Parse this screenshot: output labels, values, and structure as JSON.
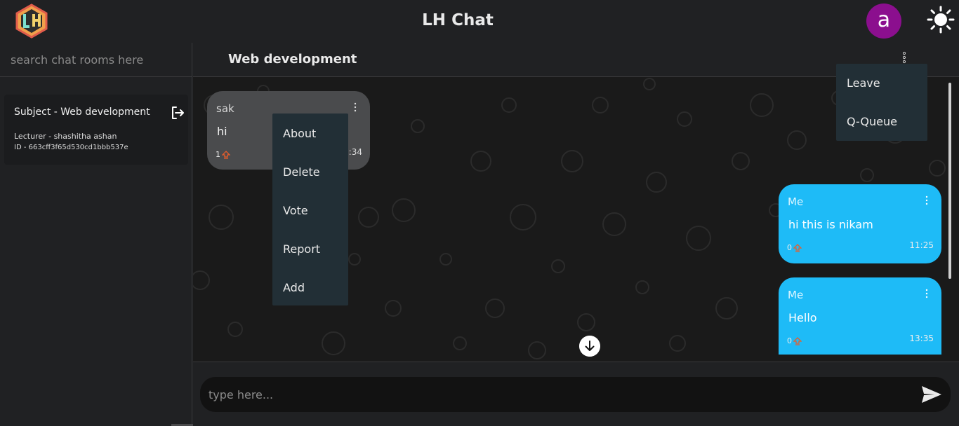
{
  "header": {
    "title": "LH Chat",
    "avatar_letter": "a",
    "logo_icon": "lh-logo-icon",
    "theme_icon": "sun-icon"
  },
  "sidebar": {
    "search_placeholder": "search chat rooms here",
    "rooms": [
      {
        "title": "Subject - Web development",
        "lecturer": "Lecturer - shashitha ashan",
        "id": "ID - 663cff3f65d530cd1bbb537e"
      }
    ]
  },
  "chat": {
    "title": "Web development",
    "room_menu": [
      "Leave",
      "Q-Queue"
    ],
    "messages": [
      {
        "sender": "sak",
        "text": "hi",
        "votes": "1",
        "time": "13:34"
      },
      {
        "sender": "Me",
        "text": "hi this is nikam",
        "votes": "0",
        "time": "11:25"
      },
      {
        "sender": "Me",
        "text": "Hello",
        "votes": "0",
        "time": "13:35"
      }
    ],
    "message_menu": [
      "About",
      "Delete",
      "Vote",
      "Report",
      "Add"
    ],
    "composer_placeholder": "type here..."
  },
  "colors": {
    "background": "#202123",
    "chat_background": "#1a1a1a",
    "my_bubble": "#1ebbf7",
    "other_bubble": "#4a4b4d",
    "menu_background": "#222f36",
    "avatar": "#8b0f8e",
    "vote_icon": "#e85d2b"
  }
}
